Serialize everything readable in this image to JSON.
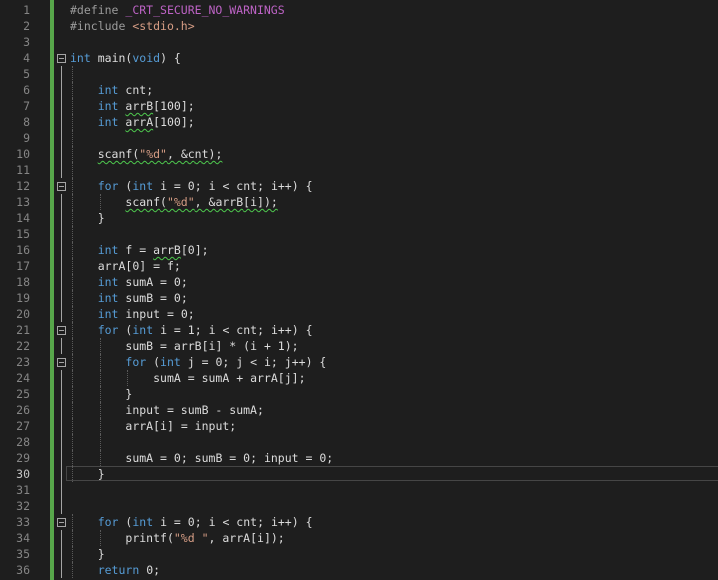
{
  "editor": {
    "current_line": 30,
    "colors": {
      "background": "#1e1e1e",
      "line_number": "#858585",
      "keyword": "#569cd6",
      "string": "#d69d85",
      "preprocessor": "#9b9b9b",
      "change_bar": "#57a64a"
    },
    "lines": [
      {
        "n": "1",
        "text": "#define _CRT_SECURE_NO_WARNINGS"
      },
      {
        "n": "2",
        "text": "#include <stdio.h>"
      },
      {
        "n": "3",
        "text": ""
      },
      {
        "n": "4",
        "text": "int main(void) {"
      },
      {
        "n": "5",
        "text": ""
      },
      {
        "n": "6",
        "text": "    int cnt;"
      },
      {
        "n": "7",
        "text": "    int arrB[100];"
      },
      {
        "n": "8",
        "text": "    int arrA[100];"
      },
      {
        "n": "9",
        "text": ""
      },
      {
        "n": "10",
        "text": "    scanf(\"%d\", &cnt);"
      },
      {
        "n": "11",
        "text": ""
      },
      {
        "n": "12",
        "text": "    for (int i = 0; i < cnt; i++) {"
      },
      {
        "n": "13",
        "text": "        scanf(\"%d\", &arrB[i]);"
      },
      {
        "n": "14",
        "text": "    }"
      },
      {
        "n": "15",
        "text": ""
      },
      {
        "n": "16",
        "text": "    int f = arrB[0];"
      },
      {
        "n": "17",
        "text": "    arrA[0] = f;"
      },
      {
        "n": "18",
        "text": "    int sumA = 0;"
      },
      {
        "n": "19",
        "text": "    int sumB = 0;"
      },
      {
        "n": "20",
        "text": "    int input = 0;"
      },
      {
        "n": "21",
        "text": "    for (int i = 1; i < cnt; i++) {"
      },
      {
        "n": "22",
        "text": "        sumB = arrB[i] * (i + 1);"
      },
      {
        "n": "23",
        "text": "        for (int j = 0; j < i; j++) {"
      },
      {
        "n": "24",
        "text": "            sumA = sumA + arrA[j];"
      },
      {
        "n": "25",
        "text": "        }"
      },
      {
        "n": "26",
        "text": "        input = sumB - sumA;"
      },
      {
        "n": "27",
        "text": "        arrA[i] = input;"
      },
      {
        "n": "28",
        "text": ""
      },
      {
        "n": "29",
        "text": "        sumA = 0; sumB = 0; input = 0;"
      },
      {
        "n": "30",
        "text": "    }"
      },
      {
        "n": "31",
        "text": ""
      },
      {
        "n": "32",
        "text": ""
      },
      {
        "n": "33",
        "text": "    for (int i = 0; i < cnt; i++) {"
      },
      {
        "n": "34",
        "text": "        printf(\"%d \", arrA[i]);"
      },
      {
        "n": "35",
        "text": "    }"
      },
      {
        "n": "36",
        "text": "    return 0;"
      }
    ]
  }
}
